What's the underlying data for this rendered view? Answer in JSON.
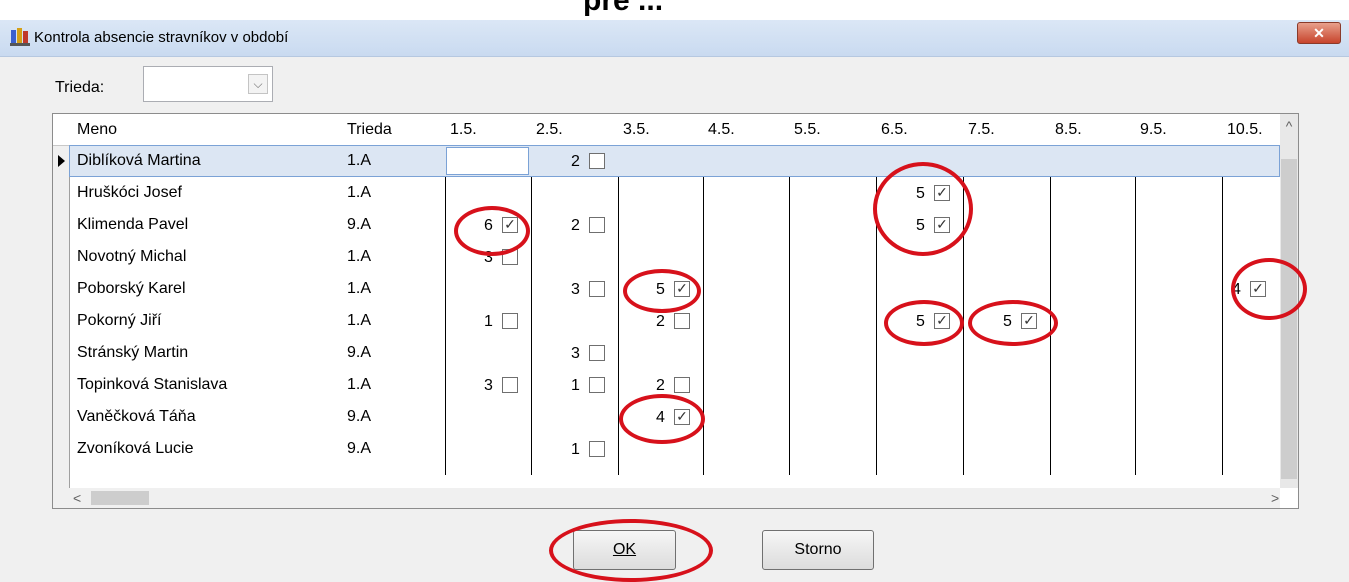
{
  "window": {
    "title": "Kontrola absencie stravníkov v období",
    "close_label": "✕"
  },
  "filter": {
    "label": "Trieda:",
    "value": ""
  },
  "grid": {
    "columns": [
      "Meno",
      "Trieda",
      "1.5.",
      "2.5.",
      "3.5.",
      "4.5.",
      "5.5.",
      "6.5.",
      "7.5.",
      "8.5.",
      "9.5.",
      "10.5."
    ],
    "rows": [
      {
        "name": "Diblíková Martina",
        "trieda": "1.A"
      },
      {
        "name": "Hruškóci Josef",
        "trieda": "1.A"
      },
      {
        "name": "Klimenda Pavel",
        "trieda": "9.A"
      },
      {
        "name": "Novotný Michal",
        "trieda": "1.A"
      },
      {
        "name": "Poborský Karel",
        "trieda": "1.A"
      },
      {
        "name": "Pokorný Jiří",
        "trieda": "1.A"
      },
      {
        "name": "Stránský Martin",
        "trieda": "9.A"
      },
      {
        "name": "Topinková Stanislava",
        "trieda": "1.A"
      },
      {
        "name": "Vaněčková Táňa",
        "trieda": "9.A"
      },
      {
        "name": "Zvoníková Lucie",
        "trieda": "9.A"
      }
    ],
    "entries": [
      {
        "row": 0,
        "day": "2.5.",
        "num": "2",
        "checked": false
      },
      {
        "row": 1,
        "day": "6.5.",
        "num": "5",
        "checked": true
      },
      {
        "row": 2,
        "day": "1.5.",
        "num": "6",
        "checked": true
      },
      {
        "row": 2,
        "day": "2.5.",
        "num": "2",
        "checked": false
      },
      {
        "row": 2,
        "day": "6.5.",
        "num": "5",
        "checked": true
      },
      {
        "row": 3,
        "day": "1.5.",
        "num": "3",
        "checked": false
      },
      {
        "row": 4,
        "day": "2.5.",
        "num": "3",
        "checked": false
      },
      {
        "row": 4,
        "day": "3.5.",
        "num": "5",
        "checked": true
      },
      {
        "row": 4,
        "day": "10.5.",
        "num": "4",
        "checked": true
      },
      {
        "row": 5,
        "day": "1.5.",
        "num": "1",
        "checked": false
      },
      {
        "row": 5,
        "day": "3.5.",
        "num": "2",
        "checked": false
      },
      {
        "row": 5,
        "day": "6.5.",
        "num": "5",
        "checked": true
      },
      {
        "row": 5,
        "day": "7.5.",
        "num": "5",
        "checked": true
      },
      {
        "row": 6,
        "day": "2.5.",
        "num": "3",
        "checked": false
      },
      {
        "row": 7,
        "day": "1.5.",
        "num": "3",
        "checked": false
      },
      {
        "row": 7,
        "day": "2.5.",
        "num": "1",
        "checked": false
      },
      {
        "row": 7,
        "day": "3.5.",
        "num": "2",
        "checked": false
      },
      {
        "row": 8,
        "day": "3.5.",
        "num": "4",
        "checked": true
      },
      {
        "row": 9,
        "day": "2.5.",
        "num": "1",
        "checked": false
      }
    ]
  },
  "buttons": {
    "ok": "OK",
    "storno": "Storno"
  },
  "highlight_color": "#d7111b"
}
